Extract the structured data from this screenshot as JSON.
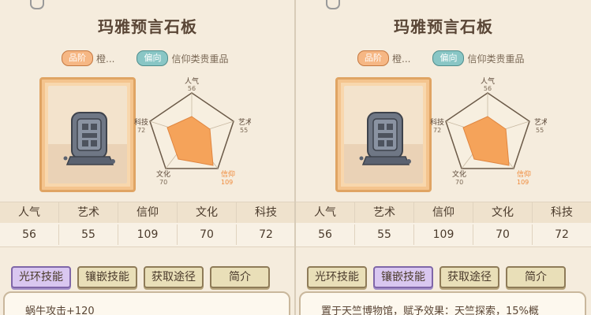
{
  "panels": [
    {
      "title": "玛雅预言石板",
      "quality_tag": "品阶",
      "quality_value": "橙...",
      "bias_tag": "偏向",
      "bias_value": "信仰类贵重品",
      "radar": [
        {
          "label": "人气",
          "value": "56"
        },
        {
          "label": "艺术",
          "value": "55"
        },
        {
          "label": "信仰",
          "value": "109"
        },
        {
          "label": "文化",
          "value": "70"
        },
        {
          "label": "科技",
          "value": "72"
        }
      ],
      "stats_headers": [
        "人气",
        "艺术",
        "信仰",
        "文化",
        "科技"
      ],
      "stats_values": [
        "56",
        "55",
        "109",
        "70",
        "72"
      ],
      "tabs": [
        "光环技能",
        "镶嵌技能",
        "获取途径",
        "简介"
      ],
      "active_tab": 0,
      "description": "蜗牛攻击+120"
    },
    {
      "title": "玛雅预言石板",
      "quality_tag": "品阶",
      "quality_value": "橙...",
      "bias_tag": "偏向",
      "bias_value": "信仰类贵重品",
      "radar": [
        {
          "label": "人气",
          "value": "56"
        },
        {
          "label": "艺术",
          "value": "55"
        },
        {
          "label": "信仰",
          "value": "109"
        },
        {
          "label": "文化",
          "value": "70"
        },
        {
          "label": "科技",
          "value": "72"
        }
      ],
      "stats_headers": [
        "人气",
        "艺术",
        "信仰",
        "文化",
        "科技"
      ],
      "stats_values": [
        "56",
        "55",
        "109",
        "70",
        "72"
      ],
      "tabs": [
        "光环技能",
        "镶嵌技能",
        "获取途径",
        "简介"
      ],
      "active_tab": 1,
      "description": "置于天竺博物馆，赋予效果：天竺探索，15%概"
    }
  ],
  "colors": {
    "radar_fill": "#f5a35a",
    "radar_highlight": "#f08a3a",
    "tab_active": "#d9c7f0",
    "tab_normal": "#e9dfb8"
  }
}
